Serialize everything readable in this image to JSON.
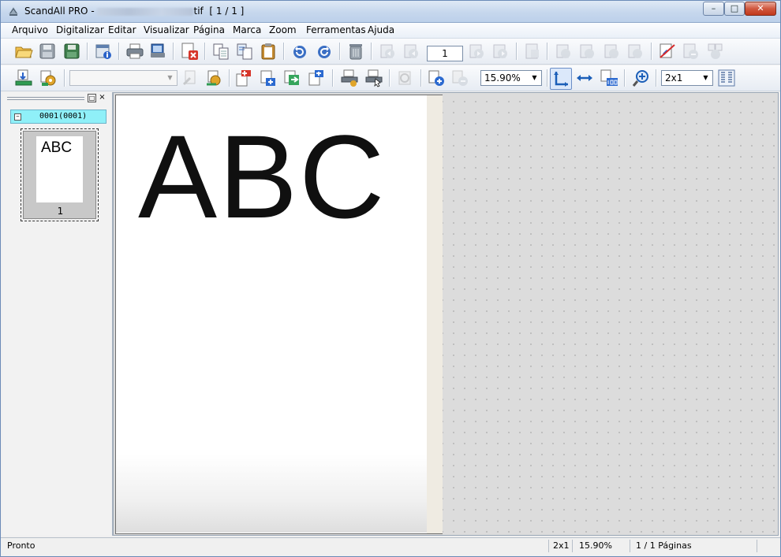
{
  "window": {
    "app_name": "ScandAll PRO -",
    "file_ext": "tif",
    "page_indicator": "[ 1 / 1 ]",
    "buttons": {
      "minimize": "–",
      "maximize": "□",
      "close": "✕"
    }
  },
  "menu": [
    "Arquivo",
    "Digitalizar",
    "Editar",
    "Visualizar",
    "Página",
    "Marca",
    "Zoom",
    "Ferramentas",
    "Ajuda"
  ],
  "toolbar1": {
    "page_number": "1",
    "icons": [
      "open-folder",
      "save",
      "save-as",
      "properties",
      "print",
      "print-preview",
      "close-document",
      "copy-page",
      "paste-page",
      "clipboard",
      "rotate-left",
      "rotate-right",
      "recycle-bin",
      "first-page",
      "previous-page",
      "next-page",
      "last-page",
      "page-size",
      "mark-first",
      "mark-previous",
      "mark-next",
      "mark-last",
      "edit-mark",
      "remove-mark",
      "remove-all-marks"
    ]
  },
  "toolbar2": {
    "profile_value": "",
    "zoom_value": "15.90%",
    "layout_value": "2x1",
    "icons": [
      "scan",
      "scan-settings",
      "print-job",
      "scanner-settings",
      "insert-before",
      "insert-after",
      "replace-page",
      "append-page",
      "scan-batch",
      "scan-select",
      "ocr",
      "zoom-in-page",
      "zoom-out-page",
      "fit-height",
      "fit-width",
      "actual-size",
      "zoom",
      "page-grid"
    ]
  },
  "sidebar": {
    "pin_label": "□",
    "close_label": "×",
    "node_toggle": "–",
    "node_label": "0001(0001)",
    "thumbnail_text": "ABC",
    "thumbnail_number": "1"
  },
  "page": {
    "text": "ABC"
  },
  "status": {
    "left": "Pronto",
    "layout": "2x1",
    "zoom": "15.90%",
    "pages": "1 / 1 Páginas"
  },
  "colors": {
    "accent": "#1c5fb8",
    "node_highlight": "#8ff0f8"
  }
}
